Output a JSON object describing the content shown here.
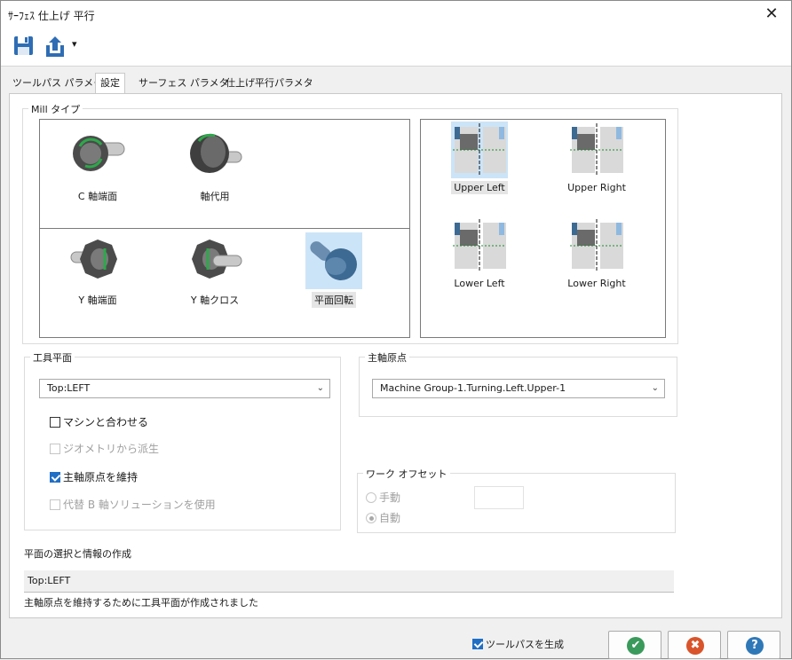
{
  "window": {
    "title": "ｻｰﾌｪｽ 仕上げ 平行",
    "close_glyph": "✕"
  },
  "toolbar": {
    "save_icon": "save-icon",
    "export_icon": "export-icon",
    "dropdown_glyph": "▾"
  },
  "tabs": [
    {
      "label": "ツールパス パラメタ"
    },
    {
      "label": "設定"
    },
    {
      "label": "サーフェス パラメタ"
    },
    {
      "label": "仕上げ平行パラメタ"
    }
  ],
  "mill_type": {
    "group_label": "Mill タイプ",
    "types": [
      {
        "label": "C 軸端面"
      },
      {
        "label": "軸代用"
      },
      {
        "label": "Y 軸端面"
      },
      {
        "label": "Y 軸クロス"
      },
      {
        "label": "平面回転"
      }
    ],
    "selected": "平面回転",
    "quadrants": [
      {
        "label": "Upper Left"
      },
      {
        "label": "Upper Right"
      },
      {
        "label": "Lower Left"
      },
      {
        "label": "Lower Right"
      }
    ],
    "selected_quadrant": "Upper Left"
  },
  "tool_plane": {
    "group_label": "工具平面",
    "value": "Top:LEFT",
    "options": [
      {
        "label": "マシンと合わせる",
        "checked": false,
        "enabled": true
      },
      {
        "label": "ジオメトリから派生",
        "checked": false,
        "enabled": false
      },
      {
        "label": "主軸原点を維持",
        "checked": true,
        "enabled": true
      },
      {
        "label": "代替 B 軸ソリューションを使用",
        "checked": false,
        "enabled": false
      }
    ]
  },
  "spindle_origin": {
    "group_label": "主軸原点",
    "value": "Machine Group-1.Turning.Left.Upper-1"
  },
  "work_offset": {
    "group_label": "ワーク オフセット",
    "manual_label": "手動",
    "auto_label": "自動",
    "selected": "auto",
    "value": ""
  },
  "plane_info": {
    "label": "平面の選択と情報の作成",
    "value": "Top:LEFT",
    "message": "主軸原点を維持するために工具平面が作成されました"
  },
  "footer": {
    "generate_toolpath_label": "ツールパスを生成",
    "generate_checked": true,
    "ok_glyph": "✔",
    "cancel_glyph": "✖",
    "help_glyph": "?"
  },
  "colors": {
    "accent": "#1f6fc5",
    "ok": "#3a9a5b",
    "cancel": "#d9542b",
    "help": "#2e78b8",
    "selection": "#cce4f7"
  }
}
